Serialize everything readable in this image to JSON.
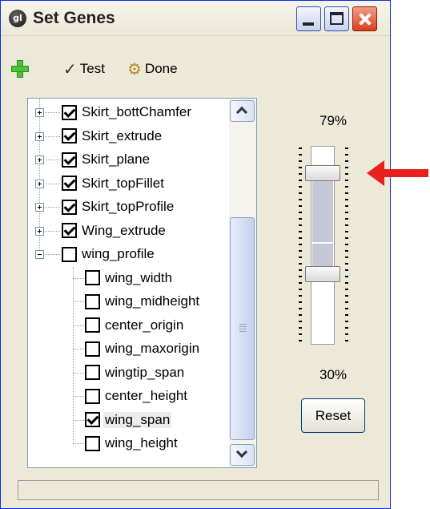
{
  "window": {
    "title": "Set Genes",
    "app_icon": "gl",
    "controls": [
      "minimize",
      "maximize",
      "close"
    ]
  },
  "toolbar": {
    "add_icon": "plus-icon",
    "test_label": "Test",
    "done_label": "Done"
  },
  "tree": {
    "items": [
      {
        "label": "Skirt_bottChamfer",
        "checked": true,
        "level": 0,
        "expander": "plus"
      },
      {
        "label": "Skirt_extrude",
        "checked": true,
        "level": 0,
        "expander": "plus"
      },
      {
        "label": "Skirt_plane",
        "checked": true,
        "level": 0,
        "expander": "plus"
      },
      {
        "label": "Skirt_topFillet",
        "checked": true,
        "level": 0,
        "expander": "plus"
      },
      {
        "label": "Skirt_topProfile",
        "checked": true,
        "level": 0,
        "expander": "plus"
      },
      {
        "label": "Wing_extrude",
        "checked": true,
        "level": 0,
        "expander": "plus"
      },
      {
        "label": "wing_profile",
        "checked": false,
        "level": 0,
        "expander": "minus"
      },
      {
        "label": "wing_width",
        "checked": false,
        "level": 1
      },
      {
        "label": "wing_midheight",
        "checked": false,
        "level": 1
      },
      {
        "label": "center_origin",
        "checked": false,
        "level": 1
      },
      {
        "label": "wing_maxorigin",
        "checked": false,
        "level": 1
      },
      {
        "label": "wingtip_span",
        "checked": false,
        "level": 1
      },
      {
        "label": "center_height",
        "checked": false,
        "level": 1
      },
      {
        "label": "wing_span",
        "checked": true,
        "level": 1,
        "selected": true
      },
      {
        "label": "wing_height",
        "checked": false,
        "level": 1
      }
    ]
  },
  "range_slider": {
    "upper_label": "79%",
    "lower_label": "30%",
    "upper_value": 0.79,
    "lower_value": 0.3
  },
  "reset_label": "Reset",
  "annotation": {
    "arrow_color": "#e8201e"
  }
}
